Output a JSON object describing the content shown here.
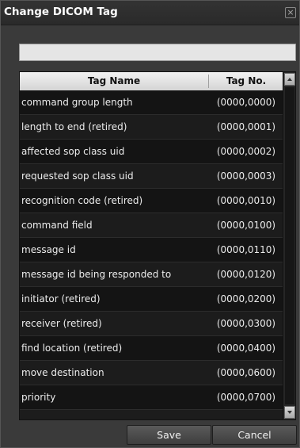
{
  "dialog": {
    "title": "Change DICOM Tag",
    "close_glyph": "×"
  },
  "search": {
    "value": "",
    "placeholder": ""
  },
  "table": {
    "columns": [
      "Tag Name",
      "Tag No."
    ],
    "rows": [
      {
        "name": "command group length",
        "no": "(0000,0000)"
      },
      {
        "name": "length to end (retired)",
        "no": "(0000,0001)"
      },
      {
        "name": "affected sop class uid",
        "no": "(0000,0002)"
      },
      {
        "name": "requested sop class uid",
        "no": "(0000,0003)"
      },
      {
        "name": "recognition code (retired)",
        "no": "(0000,0010)"
      },
      {
        "name": "command field",
        "no": "(0000,0100)"
      },
      {
        "name": "message id",
        "no": "(0000,0110)"
      },
      {
        "name": "message id being responded to",
        "no": "(0000,0120)"
      },
      {
        "name": "initiator (retired)",
        "no": "(0000,0200)"
      },
      {
        "name": "receiver (retired)",
        "no": "(0000,0300)"
      },
      {
        "name": "find location (retired)",
        "no": "(0000,0400)"
      },
      {
        "name": "move destination",
        "no": "(0000,0600)"
      },
      {
        "name": "priority",
        "no": "(0000,0700)"
      }
    ]
  },
  "buttons": {
    "save_label": "Save",
    "cancel_label": "Cancel"
  },
  "icons": {
    "close": "close-icon",
    "scroll_up": "scroll-up-arrow-icon",
    "scroll_down": "scroll-down-arrow-icon"
  },
  "colors": {
    "background": "#3a3a3a",
    "header": "#e0e0e0",
    "row_dark": "#141414",
    "row_light": "#1c1c1c"
  }
}
